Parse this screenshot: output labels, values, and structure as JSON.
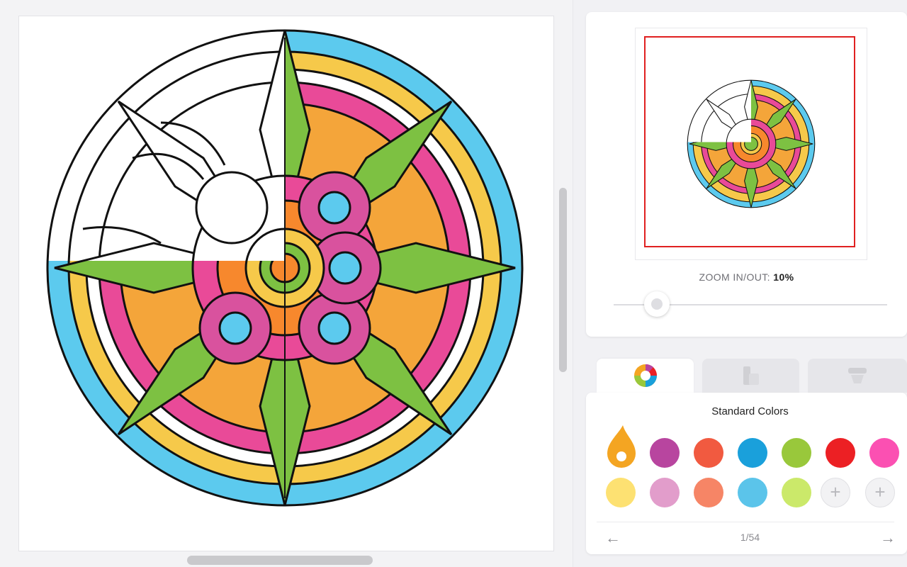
{
  "preview": {
    "zoom_label": "ZOOM IN/OUT:",
    "zoom_value": "10%"
  },
  "tabs": [
    {
      "name": "color-wheel-icon",
      "active": true
    },
    {
      "name": "gradient-icon",
      "active": false
    },
    {
      "name": "pattern-icon",
      "active": false
    }
  ],
  "palette": {
    "title": "Standard Colors",
    "selected": "#f4a522",
    "row1": [
      "#b8459f",
      "#f15a40",
      "#1aa0db",
      "#99c83b",
      "#ec2024",
      "#fb50b2"
    ],
    "row2": [
      "#fde172",
      "#e29dcb",
      "#f68566",
      "#5bc4ea",
      "#cbe96a"
    ],
    "add_buttons": [
      "+",
      "+"
    ],
    "pager": "1/54",
    "prev_icon": "arrow-left-icon",
    "next_icon": "arrow-right-icon"
  }
}
